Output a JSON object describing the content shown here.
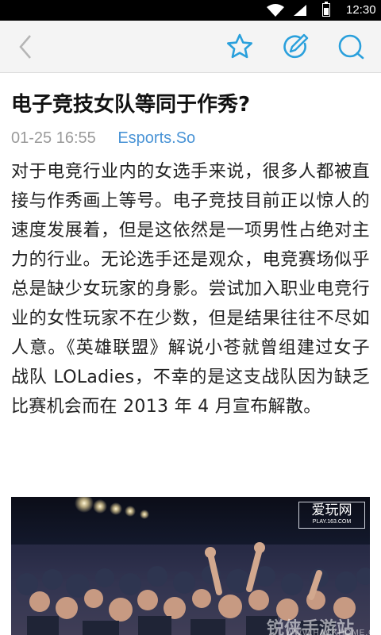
{
  "status_bar": {
    "time": "12:30"
  },
  "toolbar": {
    "icons": [
      "back-arrow-icon",
      "star-icon",
      "edit-icon",
      "comment-icon"
    ],
    "accent_color": "#2aa0dc"
  },
  "article": {
    "title": "电子竞技女队等同于作秀?",
    "date": "01-25 16:55",
    "source": "Esports.So",
    "body": "对于电竞行业内的女选手来说，很多人都被直接与作秀画上等号。电子竞技目前正以惊人的速度发展着，但是这依然是一项男性占绝对主力的行业。无论选手还是观众，电竞赛场似乎总是缺少女玩家的身影。尝试加入职业电竞行业的女性玩家不在少数，但是结果往往不尽如人意。《英雄联盟》解说小苍就曾组建过女子战队 LOLadies，不幸的是这支战队因为缺乏比赛机会而在 2013 年 4 月宣布解散。"
  },
  "photo": {
    "watermark_main": "爱玩网",
    "watermark_sub": "PLAY.163.COM",
    "watermark_bottom": "锐侠手游站",
    "watermark_url": "WWW.HACKHOME.COM"
  }
}
